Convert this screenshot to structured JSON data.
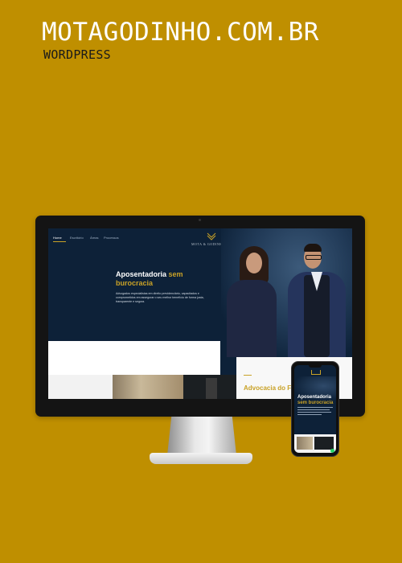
{
  "header": {
    "title": "MOTAGODINHO.COM.BR",
    "subtitle": "WORDPRESS"
  },
  "site": {
    "logo_text": "MOTA & GODINHO",
    "nav": [
      "Home",
      "Escritório",
      "Áreas",
      "Processos"
    ],
    "hero_title_white": "Aposentadoria ",
    "hero_title_accent": "sem burocracia",
    "hero_description": "Advogados especialistas em direito previdenciário, capacitados e comprometidos em assegurar o seu melhor benefício de forma justa, transparente e segura.",
    "section_title": "Advocacia do Fu"
  },
  "phone": {
    "title_white": "Aposentadoria",
    "title_accent": "sem burocracia"
  },
  "colors": {
    "background": "#bf8f00",
    "navy": "#0d2138",
    "gold_accent": "#c9a227"
  }
}
